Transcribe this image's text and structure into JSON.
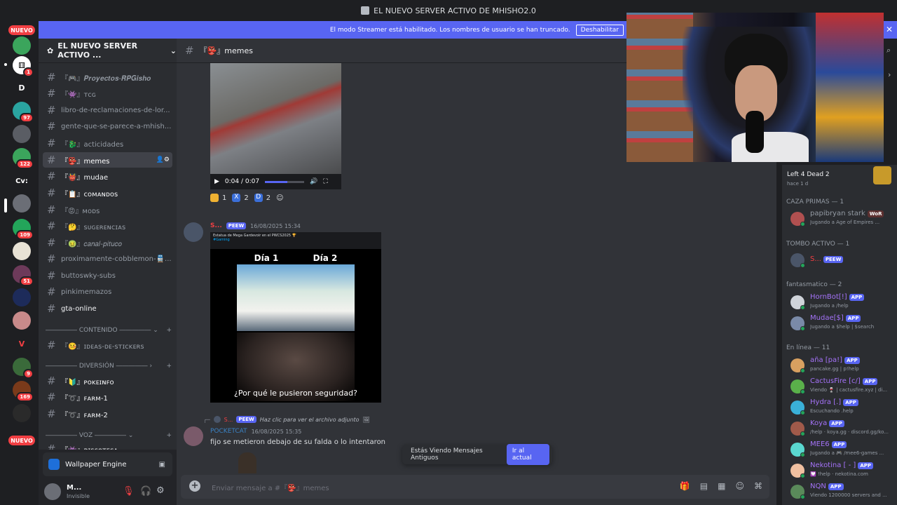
{
  "window": {
    "title": "EL NUEVO SERVER ACTIVO DE MHISHO2.0"
  },
  "banner": {
    "text": "El modo Streamer está habilitado. Los nombres de usuario se han truncado.",
    "button": "Deshabilitar"
  },
  "servers": {
    "nuevo_top": "NUEVO",
    "nuevo_bottom": "NUEVO",
    "d_label": "D",
    "cv_label": "Cv:",
    "badges": [
      "1",
      "97",
      "122",
      "109",
      "51",
      "9",
      "169"
    ]
  },
  "guild": {
    "name": "EL NUEVO SERVER ACTIVO ..."
  },
  "channels": [
    {
      "name": "『🎮』𝑷𝒓𝒐𝒚𝒆𝒄𝒕𝒐𝒔-𝑹𝑷𝑮𝒊𝒔𝒉𝒐"
    },
    {
      "name": "『👾』ᴛᴄɢ"
    },
    {
      "name": "libro-de-reclamaciones-de-lor..."
    },
    {
      "name": "gente-que-se-parece-a-mhish..."
    },
    {
      "name": "『🐉』acticidades"
    },
    {
      "name": "『👺』memes"
    },
    {
      "name": "『👹』mudae"
    },
    {
      "name": "『📋』ᴄᴏᴍᴀɴᴅᴏs"
    },
    {
      "name": "『😡』ᴍᴏᴅs"
    },
    {
      "name": "『🤔』sᴜɢᴇʀᴇɴᴄɪᴀs"
    },
    {
      "name": "『🤢』𝑐𝑎𝑛𝑎𝑙-𝑝𝑖𝑡𝑢𝑐𝑜"
    },
    {
      "name": "proximamente-cobblemon-🚆..."
    },
    {
      "name": "buttoswky-subs"
    },
    {
      "name": "pinkimemazos"
    },
    {
      "name": "gta-online"
    },
    {
      "name": "『🤒』ɪᴅᴇᴀs-ᴅᴇ-sᴛɪᴄᴋᴇʀs"
    },
    {
      "name": "『🔰』ᴘᴏᴋᴇɪɴꜰᴏ"
    },
    {
      "name": "『➰』ꜰᴀʀᴍ-1"
    },
    {
      "name": "『➰』ꜰᴀʀᴍ-2"
    },
    {
      "name": "『👾』ᴅɪsᴄᴏᴛᴇᴄᴀ"
    }
  ],
  "categories": {
    "contenido": "CONTENIDO",
    "diversion": "DIVERSIÓN",
    "voz": "VOZ"
  },
  "activity": {
    "app": "Wallpaper Engine"
  },
  "user": {
    "name": "M...",
    "status": "Invisible"
  },
  "chat": {
    "channel": "『👺』memes",
    "video_time": "0:04 / 0:07",
    "video_progress": 0.57,
    "reactions": [
      {
        "count": "1"
      },
      {
        "count": "2",
        "letter": "X"
      },
      {
        "count": "2",
        "letter": "D"
      }
    ],
    "msg2": {
      "author": "S...",
      "tag": "PEEW",
      "time": "16/08/2025 15:34",
      "embed_title": "Estatua de Mega Gardevoir en el PWCS2025 🏆",
      "embed_tag": "#Gaming",
      "dia1": "Día 1",
      "dia2": "Día 2",
      "caption": "¿Por qué le pusieron seguridad?"
    },
    "msg3": {
      "reply_tag": "PEEW",
      "reply_text": "Haz clic para ver el archivo adjunto",
      "author": "POCKETCAT",
      "time": "16/08/2025 15:35",
      "text": "fijo se metieron debajo de su falda o lo intentaron"
    },
    "old_msgs": "Estás Viendo Mensajes Antiguos",
    "go_now": "Ir al actual",
    "placeholder": "Enviar mensaje a #『👺』memes"
  },
  "members": {
    "game": {
      "name": "Left 4 Dead 2",
      "time": "hace 1 d"
    },
    "sections": [
      {
        "title": "CAZA PRIMAS — 1"
      },
      {
        "title": "TOMBO ACTIVO — 1"
      },
      {
        "title": "fantasmatico — 2"
      },
      {
        "title": "En línea — 11"
      }
    ],
    "list": [
      {
        "name": "papibryan stark",
        "tag": "WoR",
        "sub": "Jugando a Age of Empires ...",
        "color": "#949ba4"
      },
      {
        "name": "S...",
        "tag": "PEEW",
        "sub": "",
        "color": "#f23f43"
      },
      {
        "name": "HornBot[!]",
        "tag": "APP",
        "sub": "Jugando a /help",
        "color": "#a472f8"
      },
      {
        "name": "Mudae[$]",
        "tag": "APP",
        "sub": "Jugando a $help | $search",
        "color": "#a472f8"
      },
      {
        "name": "aña [pa!]",
        "tag": "APP",
        "sub": "pancake.gg | p!help",
        "color": "#a472f8"
      },
      {
        "name": "CactusFire [c/]",
        "tag": "APP",
        "sub": "Viendo 🍷 | cactusfire.xyz | di...",
        "color": "#a472f8"
      },
      {
        "name": "Hydra [.]",
        "tag": "APP",
        "sub": "Escuchando .help",
        "color": "#a472f8"
      },
      {
        "name": "Koya",
        "tag": "APP",
        "sub": "/help · koya.gg · discord.gg/ko...",
        "color": "#a472f8"
      },
      {
        "name": "MEE6",
        "tag": "APP",
        "sub": "Jugando a 🎮 /mee6-games ...",
        "color": "#a472f8"
      },
      {
        "name": "Nekotina [ - ]",
        "tag": "APP",
        "sub": "💟 !help · nekotina.com",
        "color": "#a472f8"
      },
      {
        "name": "NQN",
        "tag": "APP",
        "sub": "Viendo 1200000 servers and ...",
        "color": "#a472f8"
      }
    ]
  }
}
